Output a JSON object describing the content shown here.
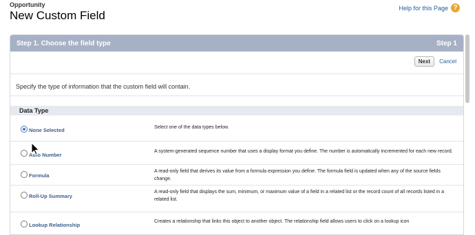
{
  "header": {
    "object_name": "Opportunity",
    "title": "New Custom Field",
    "help_link": "Help for this Page",
    "help_icon": "?"
  },
  "step": {
    "title": "Step 1. Choose the field type",
    "indicator": "Step 1"
  },
  "buttons": {
    "next": "Next",
    "cancel": "Cancel"
  },
  "description": "Specify the type of information that the custom field will contain.",
  "section": {
    "title": "Data Type"
  },
  "data_types": [
    {
      "label": "None Selected",
      "selected": true,
      "description": "Select one of the data types below."
    },
    {
      "label": "Auto Number",
      "selected": false,
      "description": "A system-generated sequence number that uses a display format you define. The number is automatically incremented for each new record."
    },
    {
      "label": "Formula",
      "selected": false,
      "description": "A read-only field that derives its value from a formula expression you define. The formula field is updated when any of the source fields change."
    },
    {
      "label": "Roll-Up Summary",
      "selected": false,
      "description": "A read-only field that displays the sum, minimum, or maximum value of a field in a related list or the record count of all records listed in a related list."
    },
    {
      "label": "Lookup Relationship",
      "selected": false,
      "description": "Creates a relationship that links this object to another object. The relationship field allows users to click on a lookup icon"
    }
  ],
  "colors": {
    "step_bar": "#a7b1c6",
    "link": "#1f5c9a",
    "help_icon": "#e8a632"
  }
}
